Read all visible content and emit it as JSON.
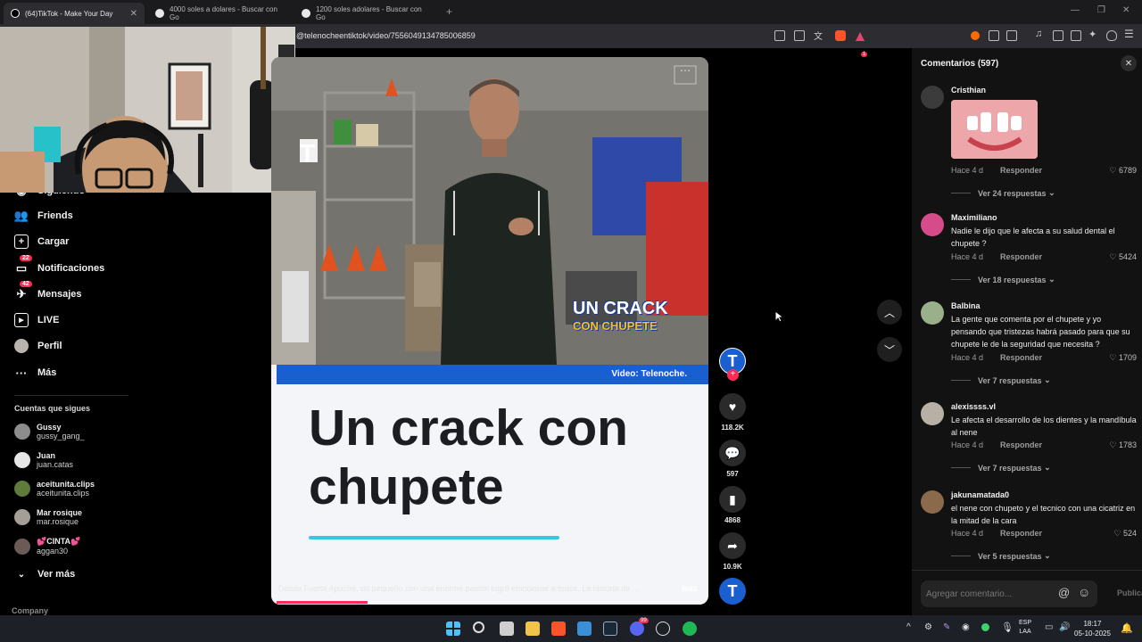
{
  "browser": {
    "tabs": [
      {
        "label": "(64)TikTok - Make Your Day",
        "active": true
      },
      {
        "label": "4000 soles a dolares - Buscar con Go",
        "active": false
      },
      {
        "label": "1200 soles adolares - Buscar con Go",
        "active": false
      }
    ],
    "new_tab": "+",
    "url": "@telenocheentiktok/video/7556049134785006859",
    "extension_badge": "1"
  },
  "sidebar": {
    "partial_item": "Siguiendo",
    "items": [
      {
        "label": "Friends",
        "icon": "friends-icon"
      },
      {
        "label": "Cargar",
        "icon": "upload-icon"
      },
      {
        "label": "Notificaciones",
        "icon": "notifications-icon",
        "badge": "22"
      },
      {
        "label": "Mensajes",
        "icon": "messages-icon",
        "badge": "42"
      },
      {
        "label": "LIVE",
        "icon": "live-icon"
      },
      {
        "label": "Perfil",
        "icon": "profile-icon"
      },
      {
        "label": "Más",
        "icon": "more-icon"
      }
    ],
    "following_title": "Cuentas que sigues",
    "following": [
      {
        "name": "Gussy",
        "handle": "gussy_gang_"
      },
      {
        "name": "Juan",
        "handle": "juan.catas"
      },
      {
        "name": "aceitunita.clips",
        "handle": "aceitunita.clips"
      },
      {
        "name": "Mar rosique",
        "handle": "mar.rosique"
      },
      {
        "name": "💕CINTA💕",
        "handle": "aggan30"
      }
    ],
    "see_more": "Ver más",
    "company": "Company"
  },
  "video": {
    "overlay_logo": "T",
    "badge_line1": "UN CRACK",
    "badge_line2": "CON CHUPETE",
    "credit": "Video: Telenoche.",
    "headline": "Un crack con chupete",
    "caption": "Desde Fuerte Apache, un pequeño con una enorme pasión logró emocionar a todos.  La historia de ...",
    "more_label": "más",
    "progress": 0.21
  },
  "actions": {
    "likes": "118.2K",
    "comments": "597",
    "saves": "4868",
    "shares": "10.9K"
  },
  "comments_panel": {
    "title": "Comentarios (597)",
    "reply_label": "Responder",
    "items": [
      {
        "user": "Cristhian",
        "text": "",
        "time": "Hace 4 d",
        "likes": "6789",
        "more": "Ver 24 respuestas",
        "has_image": true
      },
      {
        "user": "Maximiliano",
        "text": "Nadie le dijo que le afecta a su salud dental el chupete ?",
        "time": "Hace 4 d",
        "likes": "5424",
        "more": "Ver 18 respuestas"
      },
      {
        "user": "Balbina",
        "text": "La gente que comenta por el chupete y yo pensando que tristezas habrá pasado para que su chupete le de la seguridad que necesita ?",
        "time": "Hace 4 d",
        "likes": "1709",
        "more": "Ver 7 respuestas"
      },
      {
        "user": "alexissss.vl",
        "text": "Le afecta el desarrollo de los dientes y la mandíbula al nene",
        "time": "Hace 4 d",
        "likes": "1783",
        "more": "Ver 7 respuestas"
      },
      {
        "user": "jakunamatada0",
        "text": "el nene con chupeto y el tecnico con una cicatriz en la mitad de la cara",
        "time": "Hace 4 d",
        "likes": "524",
        "more": "Ver 5 respuestas"
      }
    ],
    "input_placeholder": "Agregar comentario...",
    "publish_label": "Publicar"
  },
  "taskbar": {
    "lang_line1": "ESP",
    "lang_line2": "LAA",
    "time": "18:17",
    "date": "05-10-2025",
    "discord_badge": "99"
  },
  "colors": {
    "accent": "#fe2c55",
    "brand_blue": "#1a5fd0",
    "panel": "#121212"
  }
}
